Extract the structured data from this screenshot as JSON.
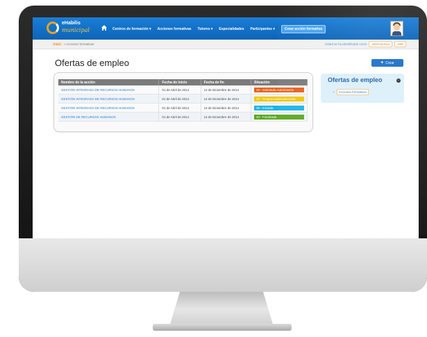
{
  "app": {
    "logo_line1": "eHabilis",
    "logo_line2": "municipal"
  },
  "nav": {
    "items": [
      {
        "label": "Centros de formación",
        "caret": true
      },
      {
        "label": "Acciones formativas",
        "caret": false
      },
      {
        "label": "Tutores",
        "caret": true
      },
      {
        "label": "Especialidades",
        "caret": false
      },
      {
        "label": "Participantes",
        "caret": true
      }
    ],
    "cta_label": "Crear acción formativa"
  },
  "breadcrumb": {
    "home": "Inicio",
    "current": "» Acciones formativas"
  },
  "session": {
    "text": "Usted se ha identificado como",
    "user": "adminiurexia",
    "exit": "Salir"
  },
  "page": {
    "title": "Ofertas de empleo",
    "create_label": "Crear"
  },
  "table": {
    "headers": [
      "Nombre de la acción",
      "Fecha de inicio",
      "Fecha de fin",
      "Situación"
    ],
    "rows": [
      {
        "name": "GESTIÓN INTEGRADA DE RECURSOS HUMANOS",
        "start": "01 de Abril de 2014",
        "end": "14 de Diciembre de 2014",
        "status": "10 - Solicitada Autorización",
        "color": "#e8601c"
      },
      {
        "name": "GESTIÓN INTEGRADA DE RECURSOS HUMANOS",
        "start": "01 de Abril de 2014",
        "end": "14 de Diciembre de 2014",
        "status": "20 - Programada/Autorizada",
        "color": "#f2c500"
      },
      {
        "name": "GESTIÓN INTEGRADA DE RECURSOS HUMANOS",
        "start": "01 de Abril de 2014",
        "end": "14 de Diciembre de 2014",
        "status": "30 - Iniciada",
        "color": "#1bb5e6"
      },
      {
        "name": "GESTIÓN DE RECURSOS HUMANOS",
        "start": "01 de Abril de 2014",
        "end": "14 de Diciembre de 2014",
        "status": "40 - Finalizada",
        "color": "#5aa81e"
      }
    ]
  },
  "side_panel": {
    "title": "Ofertas de empleo",
    "items": [
      "Acciones formativas"
    ]
  },
  "colors": {
    "topbar": "#0d64b8",
    "accent": "#1b6fc9",
    "side_panel_bg": "#dceffa"
  }
}
